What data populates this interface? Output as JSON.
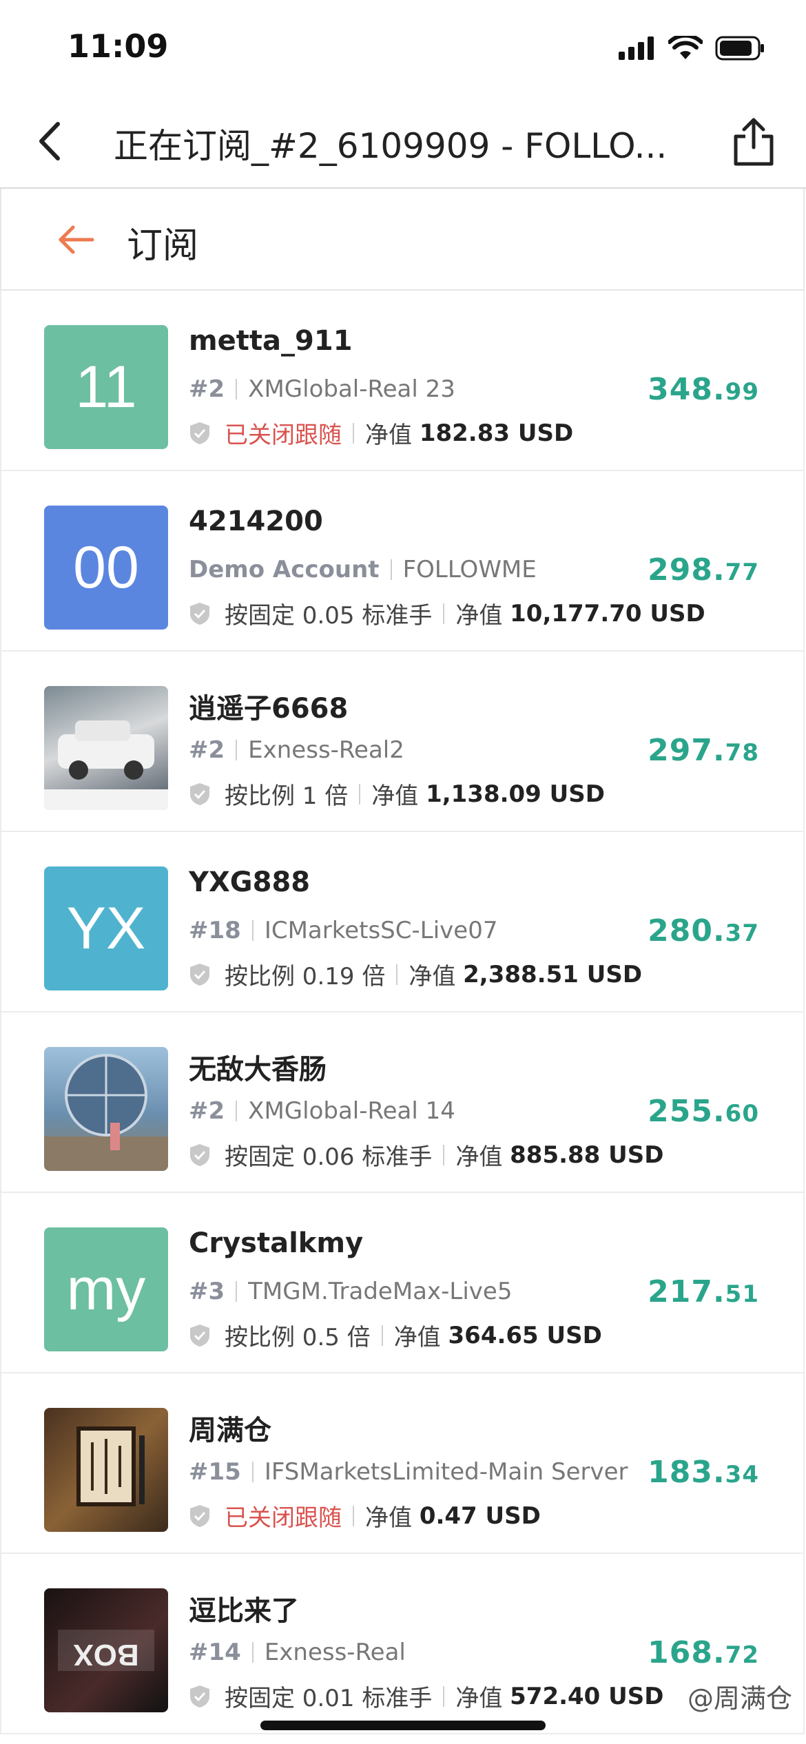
{
  "status": {
    "time": "11:09"
  },
  "nav": {
    "title": "正在订阅_#2_6109909 - FOLLO..."
  },
  "subheader": {
    "title": "订阅"
  },
  "rows": [
    {
      "avatar_text": "11",
      "avatar_color": "#6dbfa1",
      "name": "metta_911",
      "rank": "#2",
      "server": "XMGlobal-Real 23",
      "mode": "已关闭跟随",
      "mode_closed": true,
      "equity_label": "净值",
      "equity": "182.83 USD",
      "value_int": "348.",
      "value_dec": "99"
    },
    {
      "avatar_text": "00",
      "avatar_color": "#5b86e0",
      "name": "4214200",
      "rank": "Demo Account",
      "server": "FOLLOWME",
      "mode": "按固定 0.05 标准手",
      "mode_closed": false,
      "equity_label": "净值",
      "equity": "10,177.70 USD",
      "value_int": "298.",
      "value_dec": "77"
    },
    {
      "avatar_text": "",
      "avatar_color": "#55616a",
      "name": "逍遥子6668",
      "rank": "#2",
      "server": "Exness-Real2",
      "mode": "按比例 1 倍",
      "mode_closed": false,
      "equity_label": "净值",
      "equity": "1,138.09 USD",
      "value_int": "297.",
      "value_dec": "78"
    },
    {
      "avatar_text": "YX",
      "avatar_color": "#4fb3cf",
      "name": "YXG888",
      "rank": "#18",
      "server": "ICMarketsSC-Live07",
      "mode": "按比例 0.19 倍",
      "mode_closed": false,
      "equity_label": "净值",
      "equity": "2,388.51 USD",
      "value_int": "280.",
      "value_dec": "37"
    },
    {
      "avatar_text": "",
      "avatar_color": "#6b8fb0",
      "name": "无敌大香肠",
      "rank": "#2",
      "server": "XMGlobal-Real 14",
      "mode": "按固定 0.06 标准手",
      "mode_closed": false,
      "equity_label": "净值",
      "equity": "885.88 USD",
      "value_int": "255.",
      "value_dec": "60"
    },
    {
      "avatar_text": "my",
      "avatar_color": "#6dbfa1",
      "name": "Crystalkmy",
      "rank": "#3",
      "server": "TMGM.TradeMax-Live5",
      "mode": "按比例 0.5 倍",
      "mode_closed": false,
      "equity_label": "净值",
      "equity": "364.65 USD",
      "value_int": "217.",
      "value_dec": "51"
    },
    {
      "avatar_text": "",
      "avatar_color": "#6b4a2c",
      "name": "周满仓",
      "rank": "#15",
      "server": "IFSMarketsLimited-Main Server",
      "mode": "已关闭跟随",
      "mode_closed": true,
      "equity_label": "净值",
      "equity": "0.47 USD",
      "value_int": "183.",
      "value_dec": "34"
    },
    {
      "avatar_text": "",
      "avatar_color": "#2a1c1c",
      "name": "逗比来了",
      "rank": "#14",
      "server": "Exness-Real",
      "mode": "按固定 0.01 标准手",
      "mode_closed": false,
      "equity_label": "净值",
      "equity": "572.40 USD",
      "value_int": "168.",
      "value_dec": "72"
    }
  ],
  "watermark": "@周满仓"
}
